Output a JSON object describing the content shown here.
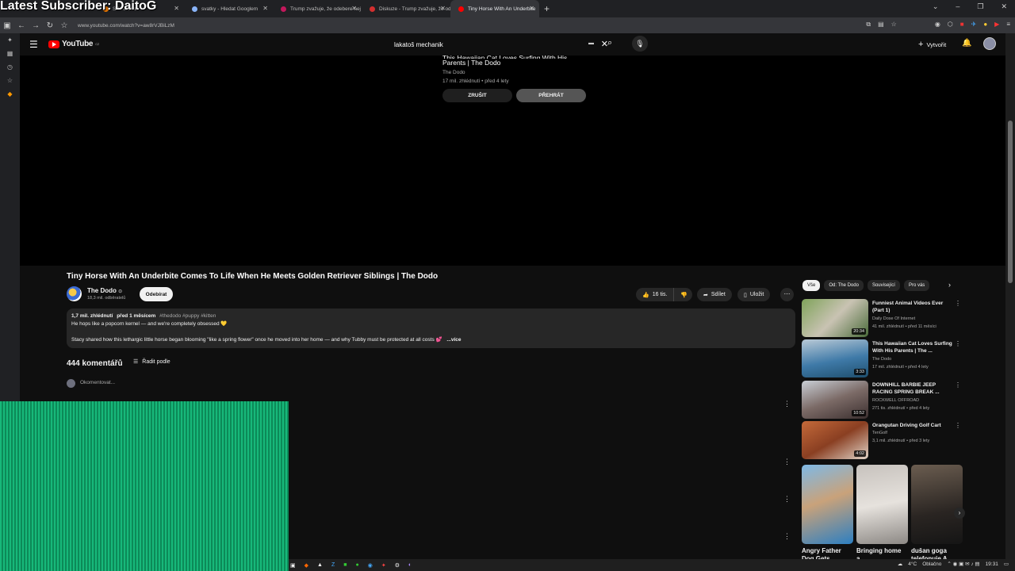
{
  "stream_overlay": "Latest Subscriber: DaitoG",
  "browser": {
    "tabs": [
      {
        "title": "SWAMP a",
        "color": "#e37400",
        "active": false
      },
      {
        "title": "svatky - Hledat Googlem",
        "color": "#8ab4f8",
        "active": false
      },
      {
        "title": "Trump zvažuje, že odebere nej",
        "color": "#c2185b",
        "active": false
      },
      {
        "title": "Diskuze - Trump zvažuje, že od",
        "color": "#d32f2f",
        "active": false
      },
      {
        "title": "Tiny Horse With An Underbite",
        "color": "#ff0000",
        "active": true
      }
    ],
    "url": "www.youtube.com/watch?v=aw8rVJBiLzM"
  },
  "youtube": {
    "logo": "YouTube",
    "logo_region": "CZ",
    "search_query": "lakatoš mechanik",
    "create_label": "Vytvořit"
  },
  "endcard": {
    "title_line1": "This Hawaiian Cat Loves Surfing With His",
    "title_line2": "Parents | The Dodo",
    "channel": "The Dodo",
    "meta": "17 mil. zhlédnutí • před 4 lety",
    "cancel_label": "ZRUŠIT",
    "play_label": "PŘEHRÁT"
  },
  "video": {
    "title": "Tiny Horse With An Underbite Comes To Life When He Meets Golden Retriever Siblings | The Dodo",
    "channel": "The Dodo",
    "verified": "⊙",
    "subscribers": "18,3 mil. odběratelů",
    "subscribe_label": "Odebírat",
    "likes": "16 tis.",
    "share_label": "Sdílet",
    "save_label": "Uložit"
  },
  "description": {
    "views": "1,7 mil. zhlédnutí",
    "date": "před 1 měsícem",
    "tags": "#thedodo #puppy #kitten",
    "line1": "He hops like a popcorn kernel — and we're completely obsessed 💛",
    "line2": "Stacy shared how this lethargic little horse began blooming \"like a spring flower\" once he moved into her home — and why Tubby must be protected at all costs 💕",
    "more_label": "...více"
  },
  "comments": {
    "count_label": "444 komentářů",
    "sort_label": "Řadit podle",
    "placeholder": "Okomentovat..."
  },
  "filter_chips": [
    "Vše",
    "Od: The Dodo",
    "Související",
    "Pro vás"
  ],
  "recommendations": [
    {
      "title": "Funniest Animal Videos Ever (Part 1)",
      "channel": "Daily Dose Of Internet",
      "meta": "41 mil. zhlédnutí • před 11 měsíci",
      "duration": "20:34"
    },
    {
      "title": "This Hawaiian Cat Loves Surfing With His Parents | The ...",
      "channel": "The Dodo",
      "meta": "17 mil. zhlédnutí • před 4 lety",
      "duration": "3:33"
    },
    {
      "title": "DOWNHILL BARBIE JEEP RACING SPRING BREAK ...",
      "channel": "ROCKWELL OFFROAD",
      "meta": "271 tis. zhlédnutí • před 4 lety",
      "duration": "10:52"
    },
    {
      "title": "Orangutan Driving Golf Cart",
      "channel": "TenGolf",
      "meta": "3,1 mil. zhlédnutí • před 3 lety",
      "duration": "4:02"
    }
  ],
  "shorts": [
    {
      "title": "Angry Father Dog Gets..."
    },
    {
      "title": "Bringing home a..."
    },
    {
      "title": "dušan goga telefonuje A..."
    }
  ],
  "taskbar": {
    "temperature": "4°C",
    "weather": "Oblačno",
    "time": "19:31"
  }
}
